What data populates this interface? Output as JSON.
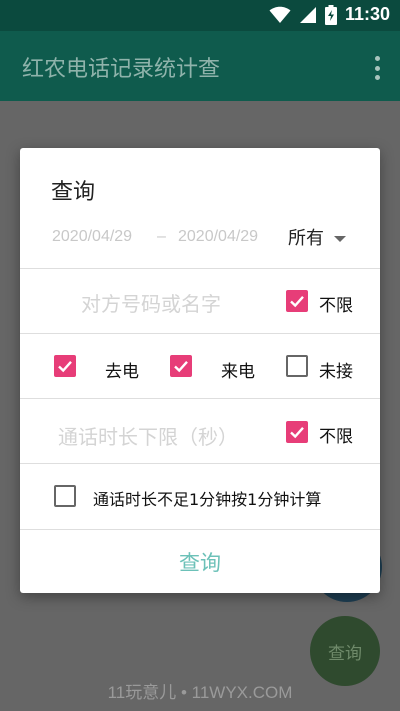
{
  "status_bar": {
    "time": "11:30",
    "icons": [
      "wifi-icon",
      "signal-icon",
      "battery-icon"
    ]
  },
  "app_bar": {
    "title": "红农电话记录统计查",
    "menu_icon": "more-vert-icon"
  },
  "dialog": {
    "title": "查询",
    "date_start": "2020/04/29",
    "date_separator": "–",
    "date_end": "2020/04/29",
    "filter_value": "所有",
    "contact_placeholder": "对方号码或名字",
    "contact_unlimited": {
      "label": "不限",
      "checked": true
    },
    "outgoing": {
      "label": "去电",
      "checked": true
    },
    "incoming": {
      "label": "来电",
      "checked": true
    },
    "missed": {
      "label": "未接",
      "checked": false
    },
    "duration_placeholder": "通话时长下限（秒）",
    "duration_unlimited": {
      "label": "不限",
      "checked": true
    },
    "round_up": {
      "label": "通话时长不足1分钟按1分钟计算",
      "checked": false
    },
    "query_label": "查询"
  },
  "background": {
    "fab_label": "查询",
    "watermark": "11玩意儿 • 11WYX.COM"
  },
  "colors": {
    "accent": "#e73d78",
    "teal": "#6cc1b8",
    "app_bar": "#0f5b4d"
  }
}
